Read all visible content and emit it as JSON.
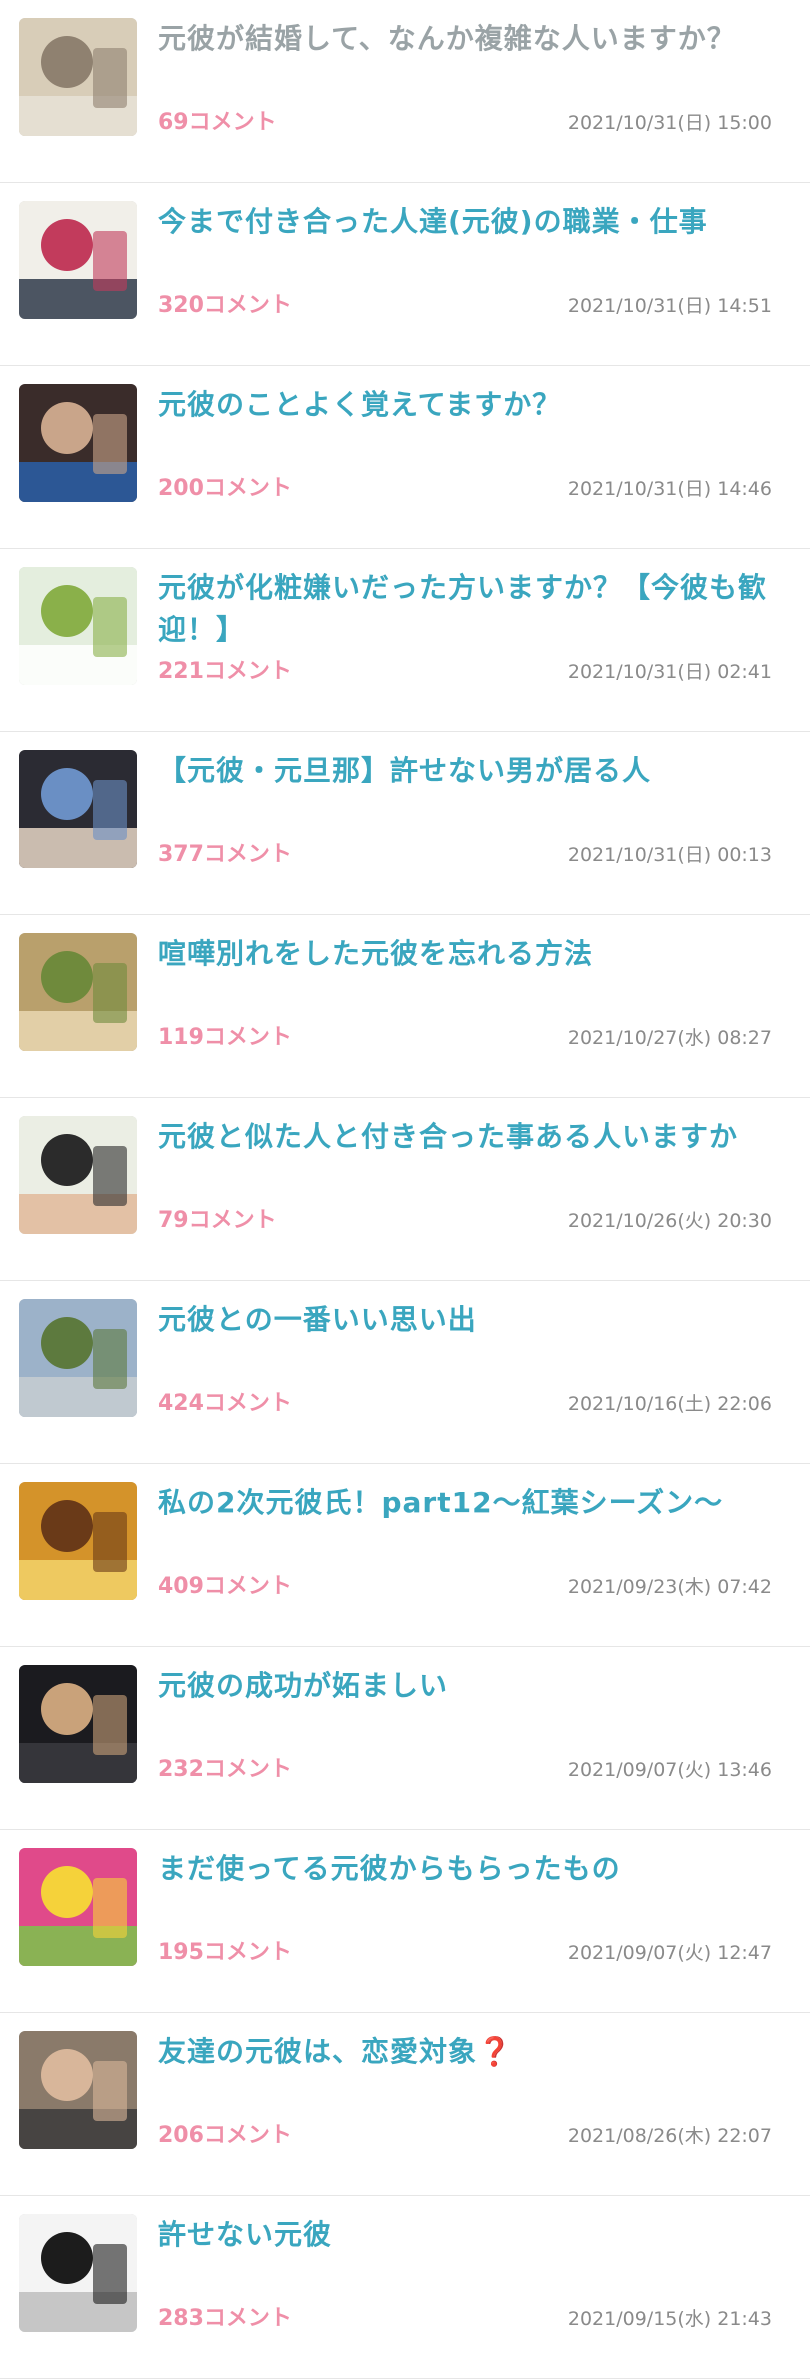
{
  "topics": [
    {
      "title": "元彼が結婚して、なんか複雑な人いますか？",
      "comments": "69コメント",
      "date": "2021/10/31(日) 15:00",
      "visited": true,
      "thumb": {
        "icon": "cat-photo",
        "bg": "#d8cdb8",
        "c1": "#8f8170",
        "c2": "#e8e2d6"
      }
    },
    {
      "title": "今まで付き合った人達(元彼)の職業・仕事",
      "comments": "320コメント",
      "date": "2021/10/31(日) 14:51",
      "visited": false,
      "thumb": {
        "icon": "dvd-cover-photo",
        "bg": "#f1efe9",
        "c1": "#c23b5c",
        "c2": "#2f3a4a"
      }
    },
    {
      "title": "元彼のことよく覚えてますか？",
      "comments": "200コメント",
      "date": "2021/10/31(日) 14:46",
      "visited": false,
      "thumb": {
        "icon": "celebrity-collage-photo",
        "bg": "#3a2c2a",
        "c1": "#c9a58a",
        "c2": "#2a5fa8"
      }
    },
    {
      "title": "元彼が化粧嫌いだった方いますか？【今彼も歓迎！】",
      "comments": "221コメント",
      "date": "2021/10/31(日) 02:41",
      "visited": false,
      "thumb": {
        "icon": "matcha-sweets-photo",
        "bg": "#e4eede",
        "c1": "#8ab04a",
        "c2": "#ffffff"
      }
    },
    {
      "title": "【元彼・元旦那】許せない男が居る人",
      "comments": "377コメント",
      "date": "2021/10/31(日) 00:13",
      "visited": false,
      "thumb": {
        "icon": "press-event-photo",
        "bg": "#2b2b33",
        "c1": "#6a8fc4",
        "c2": "#e6d6c6"
      }
    },
    {
      "title": "喧嘩別れをした元彼を忘れる方法",
      "comments": "119コメント",
      "date": "2021/10/27(水) 08:27",
      "visited": false,
      "thumb": {
        "icon": "couple-outdoor-photo",
        "bg": "#b9a06c",
        "c1": "#6f8a3c",
        "c2": "#e9d7b1"
      }
    },
    {
      "title": "元彼と似た人と付き合った事ある人いますか",
      "comments": "79コメント",
      "date": "2021/10/26(火) 20:30",
      "visited": false,
      "thumb": {
        "icon": "comedy-duo-photo",
        "bg": "#ebeee4",
        "c1": "#2b2b2b",
        "c2": "#e2b89a"
      }
    },
    {
      "title": "元彼との一番いい思い出",
      "comments": "424コメント",
      "date": "2021/10/16(土) 22:06",
      "visited": false,
      "thumb": {
        "icon": "street-scene-photo",
        "bg": "#9cb2c9",
        "c1": "#5d7a3e",
        "c2": "#c7ccd1"
      }
    },
    {
      "title": "私の2次元彼氏！part12〜紅葉シーズン〜",
      "comments": "409コメント",
      "date": "2021/09/23(木) 07:42",
      "visited": false,
      "thumb": {
        "icon": "anime-character-photo",
        "bg": "#d4932a",
        "c1": "#6a3a18",
        "c2": "#f2d26a"
      }
    },
    {
      "title": "元彼の成功が妬ましい",
      "comments": "232コメント",
      "date": "2021/09/07(火) 13:46",
      "visited": false,
      "thumb": {
        "icon": "red-carpet-photo",
        "bg": "#1b1b1f",
        "c1": "#c9a27a",
        "c2": "#3a3a40"
      }
    },
    {
      "title": "まだ使ってる元彼からもらったもの",
      "comments": "195コメント",
      "date": "2021/09/07(火) 12:47",
      "visited": false,
      "thumb": {
        "icon": "tv-show-logo-photo",
        "bg": "#e04a8a",
        "c1": "#f5d23a",
        "c2": "#7ac44a"
      }
    },
    {
      "title": "友達の元彼は、恋愛対象❓",
      "comments": "206コメント",
      "date": "2021/08/26(木) 22:07",
      "visited": false,
      "thumb": {
        "icon": "group-friends-photo",
        "bg": "#8a7a6a",
        "c1": "#d8b69a",
        "c2": "#3b3b3b"
      }
    },
    {
      "title": "許せない元彼",
      "comments": "283コメント",
      "date": "2021/09/15(水) 21:43",
      "visited": false,
      "thumb": {
        "icon": "manga-panel-photo",
        "bg": "#f4f4f4",
        "c1": "#1c1c1c",
        "c2": "#bdbdbd"
      }
    }
  ]
}
